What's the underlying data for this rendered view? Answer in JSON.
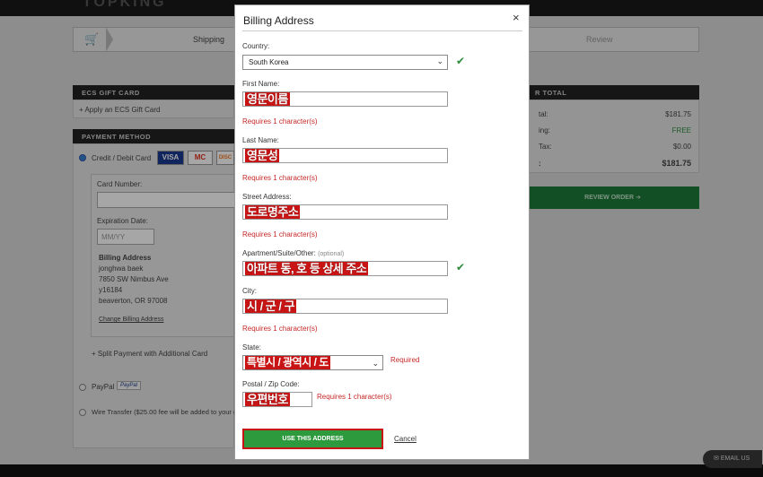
{
  "background": {
    "logo": "TOPKING",
    "steps": {
      "shipping": "Shipping",
      "review": "Review"
    },
    "gift_card": {
      "header": "ECS GIFT CARD",
      "link": "+ Apply an ECS Gift Card"
    },
    "payment": {
      "header": "PAYMENT METHOD",
      "option_card": "Credit / Debit Card",
      "card_logos": [
        "VISA",
        "MC",
        "DISC"
      ],
      "card_number_label": "Card Number:",
      "expiration_label": "Expiration Date:",
      "expiration_placeholder": "MM/YY",
      "billing_title": "Billing Address",
      "billing_lines": [
        "jonghwa baek",
        "7850 SW Nimbus Ave",
        "y16184",
        "beaverton, OR 97008"
      ],
      "change_link": "Change Billing Address",
      "split": "+ Split Payment with Additional Card",
      "paypal": "PayPal",
      "paypal_badge": "PayPal",
      "wire": "Wire Transfer ($25.00 fee will be added to your o"
    },
    "summary": {
      "header": "R TOTAL",
      "rows": [
        {
          "label": "tal:",
          "value": "$181.75"
        },
        {
          "label": "ing:",
          "value": "FREE"
        },
        {
          "label": "Tax:",
          "value": "$0.00"
        },
        {
          "label": ":",
          "value": "$181.75"
        }
      ],
      "review_button": "REVIEW ORDER ➔"
    },
    "email_us": "EMAIL US"
  },
  "modal": {
    "title": "Billing Address",
    "close": "×",
    "country_label": "Country:",
    "country_value": "South Korea",
    "first_name_label": "First Name:",
    "first_name_value": "영문이름",
    "first_name_error": "Requires 1 character(s)",
    "last_name_label": "Last Name:",
    "last_name_value": "영문성",
    "last_name_error": "Requires 1 character(s)",
    "street_label": "Street Address:",
    "street_value": "도로명주소",
    "street_error": "Requires 1 character(s)",
    "apt_label": "Apartment/Suite/Other:",
    "apt_optional": "(optional)",
    "apt_value": "아파트 동, 호 등 상세 주소",
    "city_label": "City:",
    "city_value": "시 / 군 / 구",
    "city_error": "Requires 1 character(s)",
    "state_label": "State:",
    "state_value": "특별시 / 광역시 / 도",
    "state_error": "Required",
    "postal_label": "Postal / Zip Code:",
    "postal_value": "우편번호",
    "postal_error": "Requires 1 character(s)",
    "submit_label": "USE THIS ADDRESS",
    "cancel_label": "Cancel",
    "check_glyph": "✔"
  },
  "colors": {
    "accent_green": "#2e9a3e",
    "error_red": "#c62828",
    "annotation_red": "#c81414"
  }
}
